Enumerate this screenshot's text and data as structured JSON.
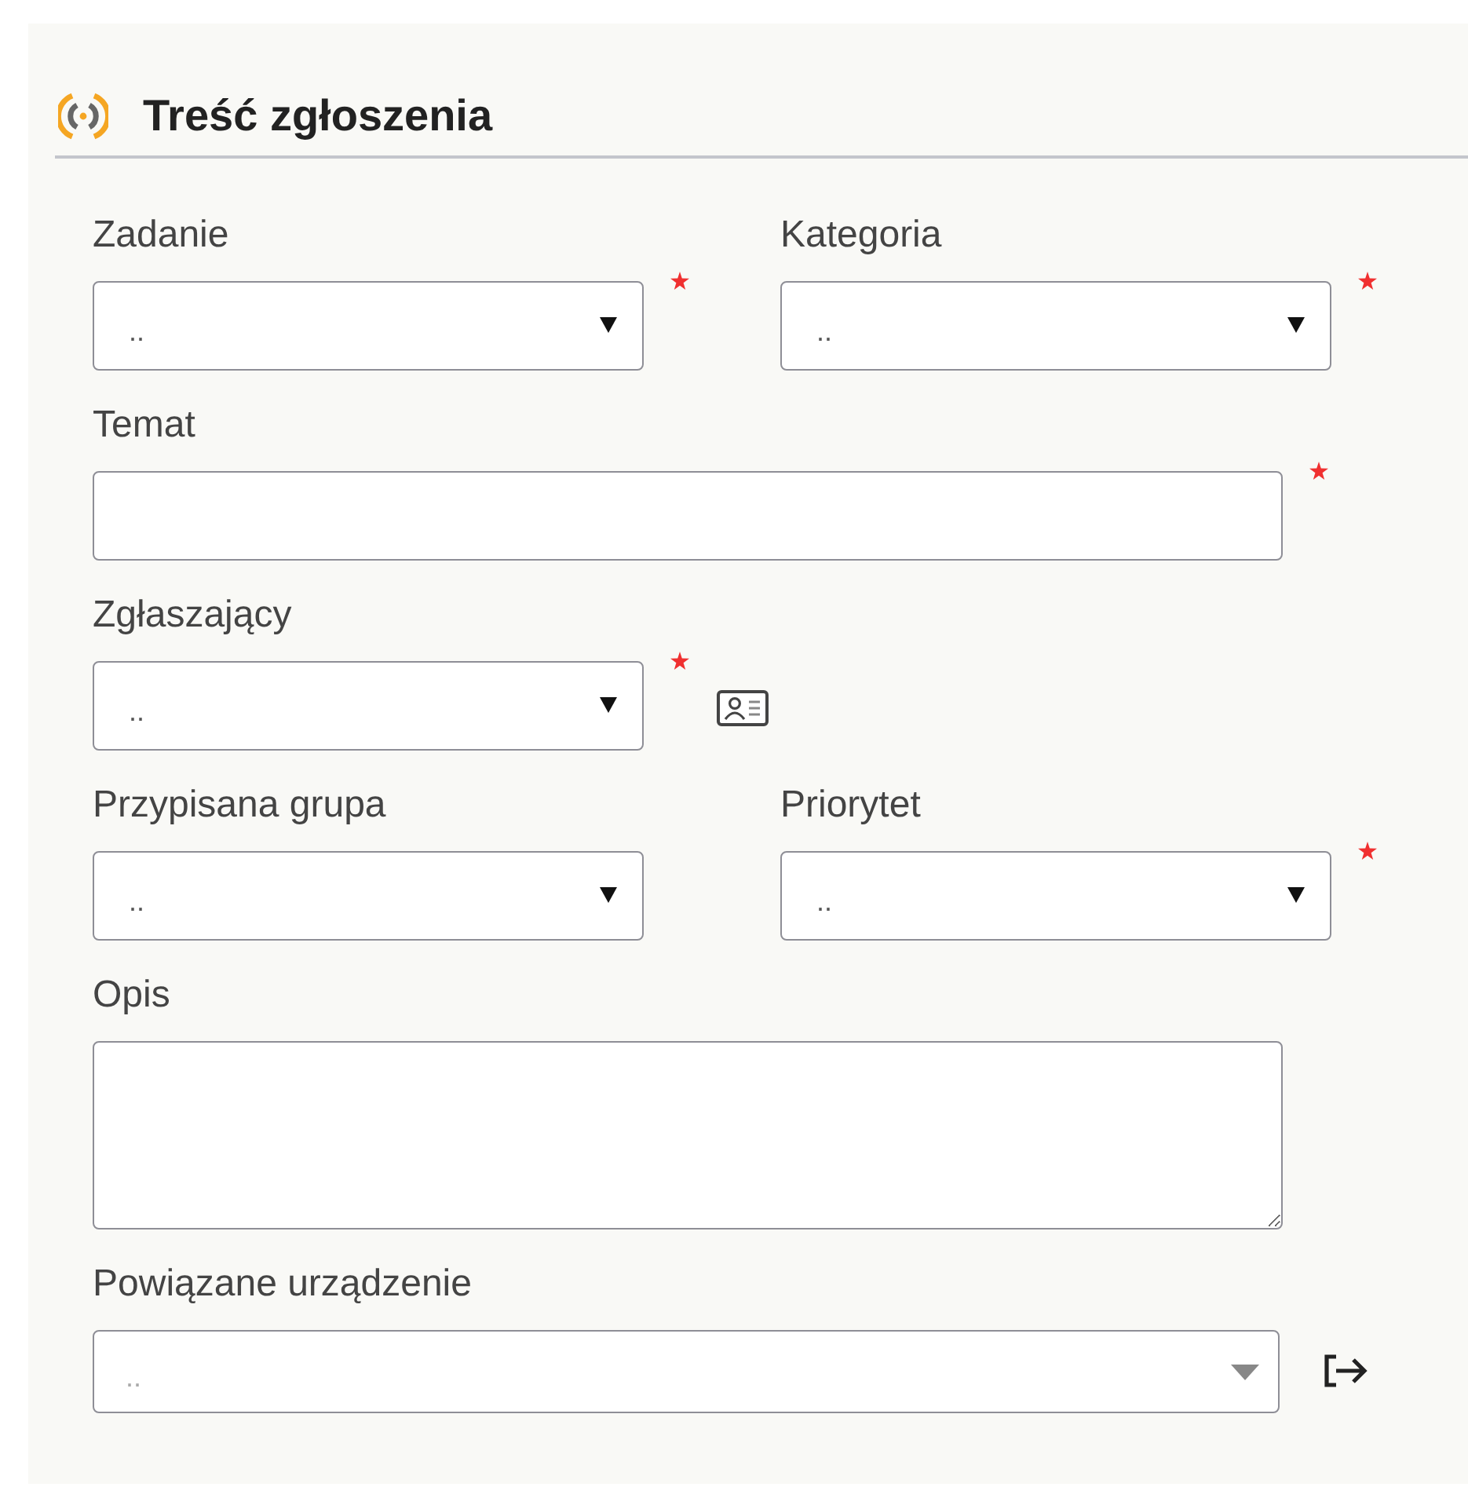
{
  "section": {
    "title": "Treść zgłoszenia"
  },
  "rows": [
    {
      "fields": [
        {
          "label": "Zadanie",
          "kind": "select",
          "value": "..",
          "required": true
        },
        {
          "label": "Kategoria",
          "kind": "select",
          "value": "..",
          "required": true
        }
      ]
    },
    {
      "fields": [
        {
          "label": "Temat",
          "kind": "text",
          "required": true
        }
      ]
    },
    {
      "fields": [
        {
          "label": "Zgłaszający",
          "kind": "select",
          "value": "..",
          "required": true,
          "button": {
            "kind": "contact"
          }
        }
      ]
    },
    {
      "fields": [
        {
          "label": "Przypisana grupa",
          "kind": "select",
          "value": "..",
          "required": false
        },
        {
          "label": "Priorytet",
          "kind": "select",
          "value": "..",
          "required": true
        }
      ]
    },
    {
      "fields": [
        {
          "label": "Opis",
          "kind": "textarea",
          "required": false
        }
      ]
    },
    {
      "fields": [
        {
          "label": "Powiązane urządzenie",
          "kind": "combobox",
          "value": "..",
          "required": false,
          "disabled": true,
          "button": {
            "kind": "link"
          }
        }
      ]
    }
  ]
}
